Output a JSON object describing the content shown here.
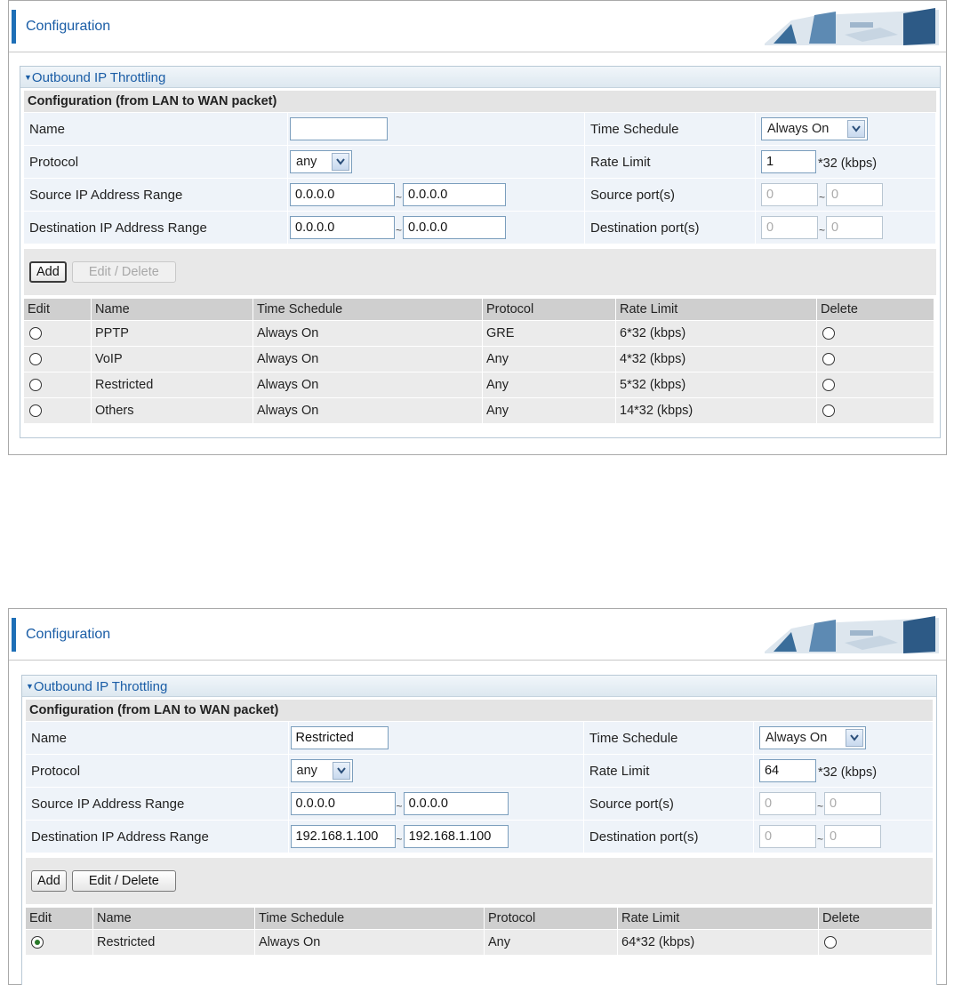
{
  "panels": [
    {
      "header_title": "Configuration",
      "section_title": "Outbound IP Throttling",
      "subheader": "Configuration (from LAN to WAN packet)",
      "fields": {
        "name_label": "Name",
        "name_value": "",
        "time_schedule_label": "Time Schedule",
        "time_schedule_value": "Always On",
        "protocol_label": "Protocol",
        "protocol_value": "any",
        "rate_limit_label": "Rate Limit",
        "rate_limit_value": "1",
        "rate_unit": "*32 (kbps)",
        "src_ip_label": "Source IP Address Range",
        "src_ip_start": "0.0.0.0",
        "src_ip_end": "0.0.0.0",
        "src_port_label": "Source port(s)",
        "src_port_start": "0",
        "src_port_end": "0",
        "dst_ip_label": "Destination IP Address Range",
        "dst_ip_start": "0.0.0.0",
        "dst_ip_end": "0.0.0.0",
        "dst_port_label": "Destination port(s)",
        "dst_port_start": "0",
        "dst_port_end": "0"
      },
      "buttons": {
        "add": "Add",
        "edit_delete": "Edit / Delete"
      },
      "columns": [
        "Edit",
        "Name",
        "Time Schedule",
        "Protocol",
        "Rate Limit",
        "Delete"
      ],
      "rows": [
        {
          "name": "PPTP",
          "schedule": "Always On",
          "protocol": "GRE",
          "rate": "6*32 (kbps)"
        },
        {
          "name": "VoIP",
          "schedule": "Always On",
          "protocol": "Any",
          "rate": "4*32 (kbps)"
        },
        {
          "name": "Restricted",
          "schedule": "Always On",
          "protocol": "Any",
          "rate": "5*32 (kbps)"
        },
        {
          "name": "Others",
          "schedule": "Always On",
          "protocol": "Any",
          "rate": "14*32 (kbps)"
        }
      ]
    },
    {
      "header_title": "Configuration",
      "section_title": "Outbound IP Throttling",
      "subheader": "Configuration (from LAN to WAN packet)",
      "fields": {
        "name_label": "Name",
        "name_value": "Restricted",
        "time_schedule_label": "Time Schedule",
        "time_schedule_value": "Always On",
        "protocol_label": "Protocol",
        "protocol_value": "any",
        "rate_limit_label": "Rate Limit",
        "rate_limit_value": "64",
        "rate_unit": "*32 (kbps)",
        "src_ip_label": "Source IP Address Range",
        "src_ip_start": "0.0.0.0",
        "src_ip_end": "0.0.0.0",
        "src_port_label": "Source port(s)",
        "src_port_start": "0",
        "src_port_end": "0",
        "dst_ip_label": "Destination IP Address Range",
        "dst_ip_start": "192.168.1.100",
        "dst_ip_end": "192.168.1.100",
        "dst_port_label": "Destination port(s)",
        "dst_port_start": "0",
        "dst_port_end": "0"
      },
      "buttons": {
        "add": "Add",
        "edit_delete": "Edit / Delete"
      },
      "columns": [
        "Edit",
        "Name",
        "Time Schedule",
        "Protocol",
        "Rate Limit",
        "Delete"
      ],
      "rows": [
        {
          "name": "Restricted",
          "schedule": "Always On",
          "protocol": "Any",
          "rate": "64*32 (kbps)",
          "selected": true
        }
      ]
    }
  ]
}
